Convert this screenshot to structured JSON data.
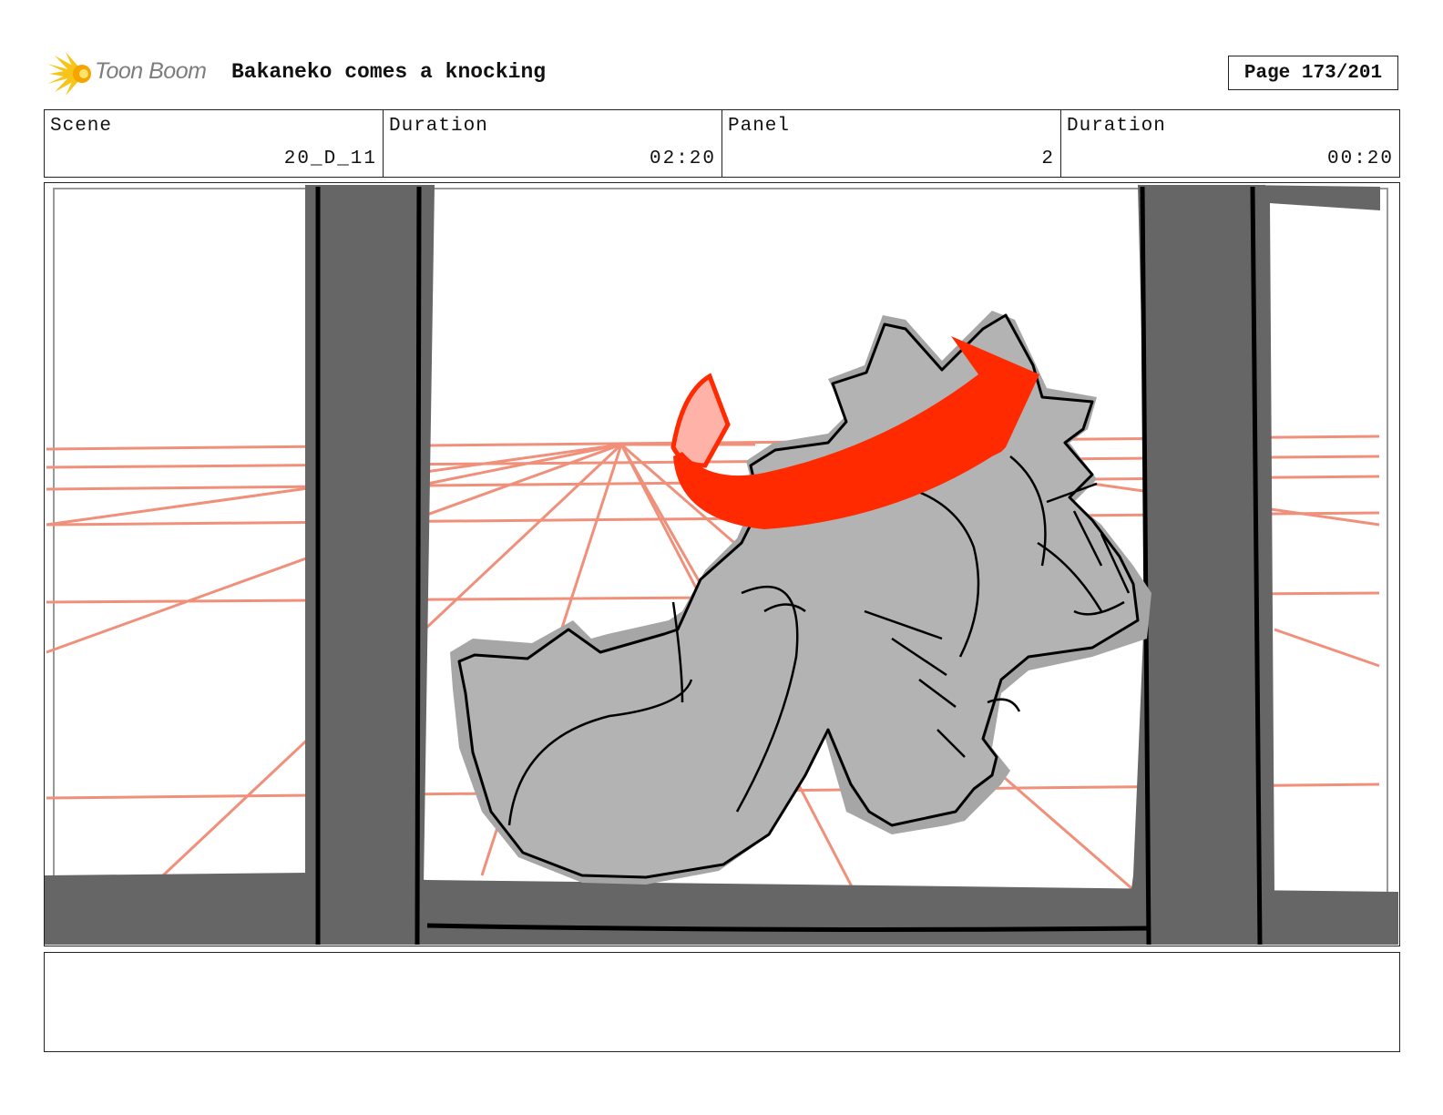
{
  "header": {
    "logo_text": "Toon Boom",
    "project_title": "Bakaneko comes a knocking",
    "page_label": "Page 173/201"
  },
  "info": {
    "scene_label": "Scene",
    "scene_value": "20_D_11",
    "scene_duration_label": "Duration",
    "scene_duration_value": "02:20",
    "panel_label": "Panel",
    "panel_value": "2",
    "panel_duration_label": "Duration",
    "panel_duration_value": "00:20"
  },
  "colors": {
    "perspective_lines": "#f0907a",
    "frame_dark": "#666666",
    "creature_fill": "#b3b3b3",
    "arrow_red": "#ff2a00",
    "ear_pink": "#ffb3a8",
    "logo_yellow": "#f7c51a"
  }
}
